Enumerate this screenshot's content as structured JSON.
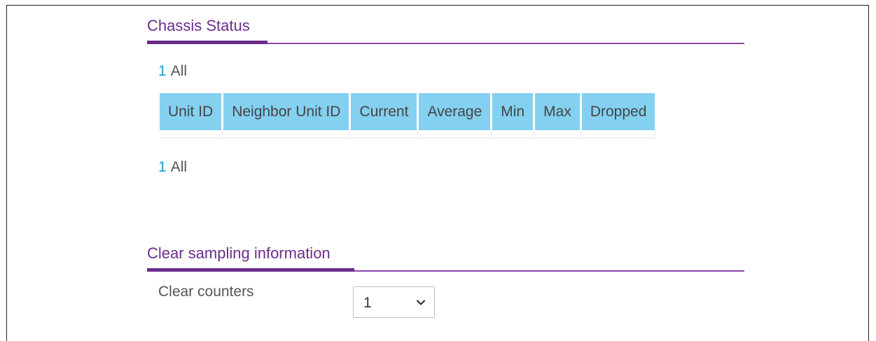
{
  "chassis_status": {
    "title": "Chassis Status",
    "pager_top": {
      "page": "1",
      "all": "All"
    },
    "pager_bottom": {
      "page": "1",
      "all": "All"
    },
    "columns": [
      "Unit ID",
      "Neighbor Unit ID",
      "Current",
      "Average",
      "Min",
      "Max",
      "Dropped"
    ],
    "rows": []
  },
  "clear_sampling": {
    "title": "Clear sampling information",
    "clear_counters_label": "Clear counters",
    "clear_counters_value": "1",
    "chevron_icon": "chevron-down-icon"
  },
  "colors": {
    "accent": "#6b2d8c",
    "header_bg": "#84d0f0",
    "link": "#1a9ad6"
  }
}
